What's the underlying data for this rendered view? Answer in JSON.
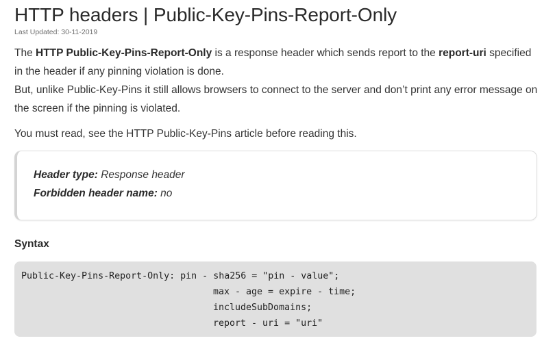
{
  "article": {
    "title": "HTTP headers | Public-Key-Pins-Report-Only",
    "last_updated": "Last Updated: 30-11-2019",
    "intro": {
      "t1": "The ",
      "b1": "HTTP Public-Key-Pins-Report-Only",
      "t2": " is a response header which sends report to the ",
      "b2": "report-uri",
      "t3": " specified in the header if any pinning violation is done.",
      "t4": "But, unlike Public-Key-Pins it still allows browsers to connect to the server and don’t print any error message on the screen if the pinning is violated."
    },
    "must_read": "You must read, see the HTTP Public-Key-Pins article before reading this.",
    "info": {
      "header_type_label": "Header type:",
      "header_type_value": " Response header",
      "forbidden_label": "Forbidden header name:",
      "forbidden_value": " no"
    },
    "syntax_heading": "Syntax",
    "code_lines": [
      "Public-Key-Pins-Report-Only: pin - sha256 = \"pin - value\";",
      "max - age = expire - time;",
      "includeSubDomains;",
      "report - uri = \"uri\""
    ]
  }
}
